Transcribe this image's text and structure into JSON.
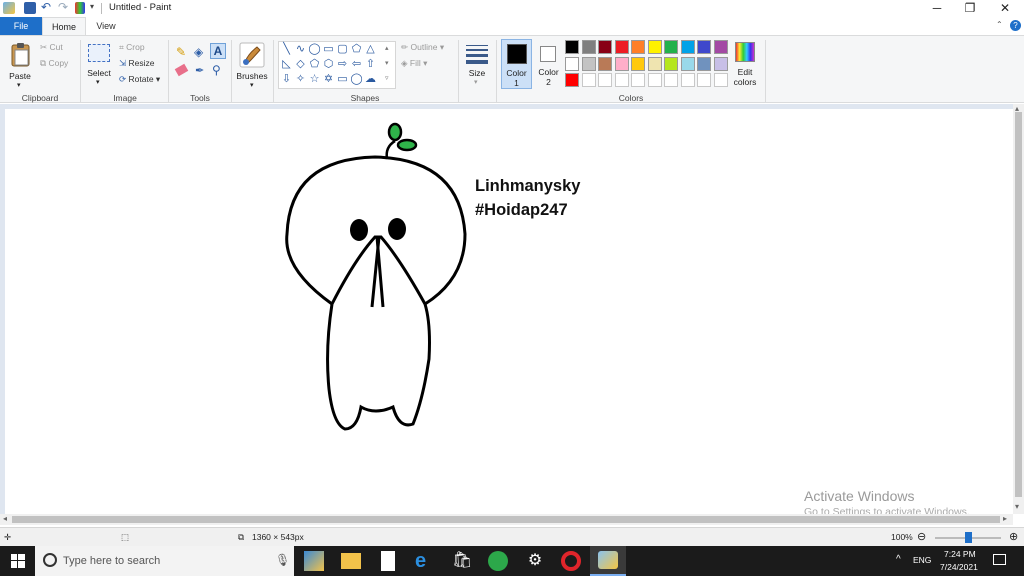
{
  "window": {
    "title": "Untitled - Paint",
    "controls": {
      "minimize": "─",
      "restore": "❐",
      "close": "✕"
    }
  },
  "menu": {
    "tabs": [
      {
        "label": "File"
      },
      {
        "label": "Home"
      },
      {
        "label": "View"
      }
    ]
  },
  "ribbon": {
    "clipboard": {
      "paste": "Paste",
      "cut": "Cut",
      "copy": "Copy",
      "group": "Clipboard"
    },
    "image": {
      "select": "Select",
      "crop": "Crop",
      "resize": "Resize",
      "rotate": "Rotate",
      "group": "Image"
    },
    "tools": {
      "group": "Tools"
    },
    "brushes": {
      "label": "Brushes"
    },
    "shapes": {
      "outline": "Outline",
      "fill": "Fill",
      "group": "Shapes"
    },
    "size": {
      "label": "Size"
    },
    "color1": {
      "label": "Color",
      "num": "1"
    },
    "color2": {
      "label": "Color",
      "num": "2"
    },
    "edit_colors": {
      "line1": "Edit",
      "line2": "colors"
    },
    "colors_group": "Colors",
    "palette_row1": [
      "#000000",
      "#7f7f7f",
      "#880015",
      "#ed1c24",
      "#ff7f27",
      "#fff200",
      "#22b14c",
      "#00a2e8",
      "#3f48cc",
      "#a349a4"
    ],
    "palette_row2": [
      "#ffffff",
      "#c3c3c3",
      "#b97a57",
      "#ffaec9",
      "#ffc90e",
      "#efe4b0",
      "#b5e61d",
      "#99d9ea",
      "#7092be",
      "#c8bfe7"
    ],
    "palette_row3_first": "#ff0000",
    "color1_value": "#000000",
    "color2_value": "#ffffff"
  },
  "canvas": {
    "text_line1": "Linhmanysky",
    "text_line2": "#Hoidap247"
  },
  "watermark": {
    "line1": "Activate Windows",
    "line2": "Go to Settings to activate Windows."
  },
  "status": {
    "dimensions": "1360 × 543px",
    "zoom": "100%",
    "zoom_minus": "⊖",
    "zoom_plus": "⊕"
  },
  "taskbar": {
    "search_placeholder": "Type here to search",
    "language": "ENG",
    "time": "7:24 PM",
    "date": "7/24/2021"
  }
}
